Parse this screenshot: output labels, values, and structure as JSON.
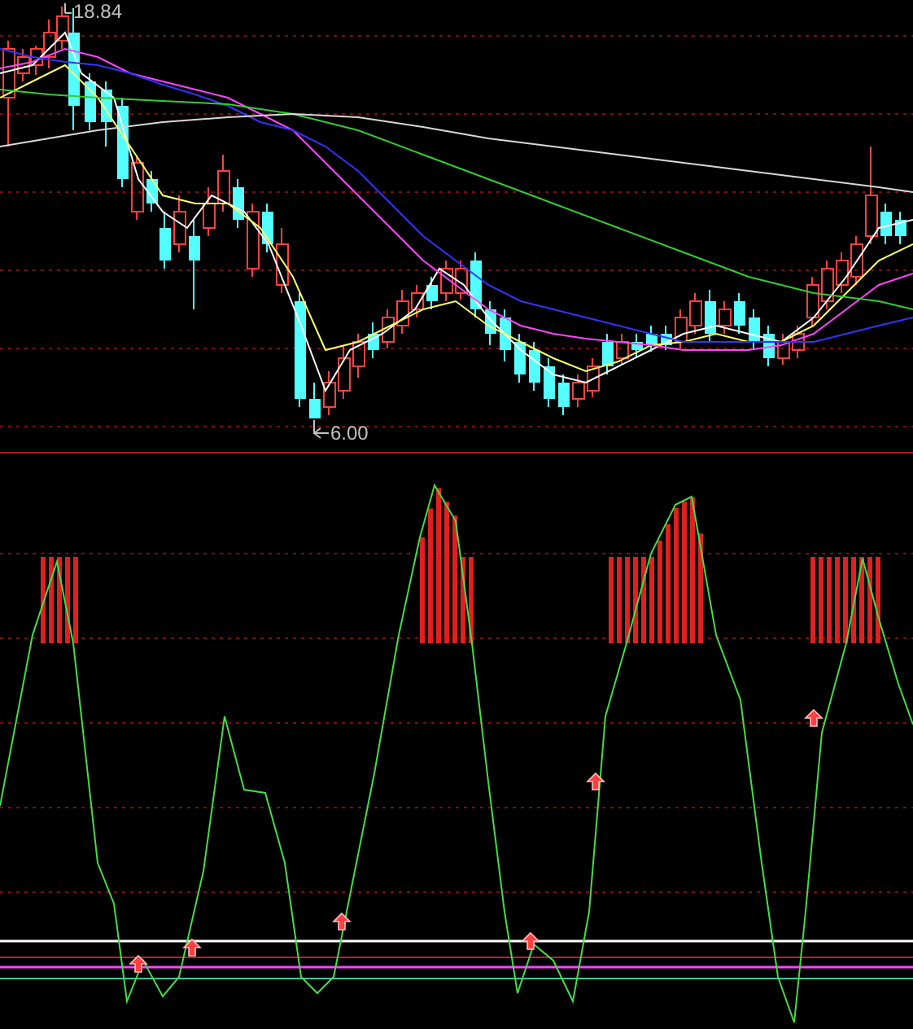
{
  "price_chart": {
    "high_label": "18.84",
    "low_label": "6.00"
  }
}
